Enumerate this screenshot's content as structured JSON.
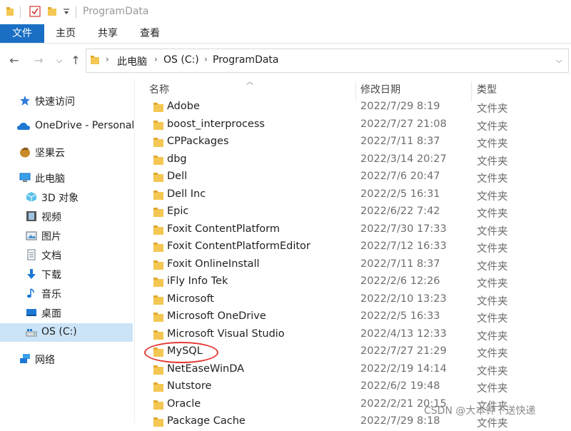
{
  "window": {
    "title": "ProgramData"
  },
  "ribbon": {
    "tabs": [
      "文件",
      "主页",
      "共享",
      "查看"
    ]
  },
  "address": {
    "path": [
      "此电脑",
      "OS (C:)",
      "ProgramData"
    ]
  },
  "sidebar": {
    "items": [
      {
        "label": "快速访问",
        "icon": "star-icon"
      },
      {
        "label": "OneDrive - Personal",
        "icon": "cloud-icon"
      },
      {
        "label": "坚果云",
        "icon": "nut-icon"
      },
      {
        "label": "此电脑",
        "icon": "computer-icon"
      },
      {
        "label": "3D 对象",
        "icon": "cube-icon"
      },
      {
        "label": "视频",
        "icon": "video-icon"
      },
      {
        "label": "图片",
        "icon": "picture-icon"
      },
      {
        "label": "文档",
        "icon": "document-icon"
      },
      {
        "label": "下载",
        "icon": "download-icon"
      },
      {
        "label": "音乐",
        "icon": "music-icon"
      },
      {
        "label": "桌面",
        "icon": "desktop-icon"
      },
      {
        "label": "OS (C:)",
        "icon": "drive-icon",
        "selected": true
      },
      {
        "label": "网络",
        "icon": "network-icon"
      }
    ]
  },
  "columns": {
    "name": "名称",
    "date": "修改日期",
    "type": "类型"
  },
  "files": [
    {
      "name": "Adobe",
      "date": "2022/7/29 8:19",
      "type": "文件夹"
    },
    {
      "name": "boost_interprocess",
      "date": "2022/7/27 21:08",
      "type": "文件夹"
    },
    {
      "name": "CPPackages",
      "date": "2022/7/11 8:37",
      "type": "文件夹"
    },
    {
      "name": "dbg",
      "date": "2022/3/14 20:27",
      "type": "文件夹"
    },
    {
      "name": "Dell",
      "date": "2022/7/6 20:47",
      "type": "文件夹"
    },
    {
      "name": "Dell Inc",
      "date": "2022/2/5 16:31",
      "type": "文件夹"
    },
    {
      "name": "Epic",
      "date": "2022/6/22 7:42",
      "type": "文件夹"
    },
    {
      "name": "Foxit ContentPlatform",
      "date": "2022/7/30 17:33",
      "type": "文件夹"
    },
    {
      "name": "Foxit ContentPlatformEditor",
      "date": "2022/7/12 16:33",
      "type": "文件夹"
    },
    {
      "name": "Foxit OnlineInstall",
      "date": "2022/7/11 8:37",
      "type": "文件夹"
    },
    {
      "name": "iFly Info Tek",
      "date": "2022/2/6 12:26",
      "type": "文件夹"
    },
    {
      "name": "Microsoft",
      "date": "2022/2/10 13:23",
      "type": "文件夹"
    },
    {
      "name": "Microsoft OneDrive",
      "date": "2022/2/5 16:33",
      "type": "文件夹"
    },
    {
      "name": "Microsoft Visual Studio",
      "date": "2022/4/13 12:33",
      "type": "文件夹"
    },
    {
      "name": "MySQL",
      "date": "2022/7/27 21:29",
      "type": "文件夹"
    },
    {
      "name": "NetEaseWinDA",
      "date": "2022/2/19 14:14",
      "type": "文件夹"
    },
    {
      "name": "Nutstore",
      "date": "2022/6/2 19:48",
      "type": "文件夹"
    },
    {
      "name": "Oracle",
      "date": "2022/2/21 20:15",
      "type": "文件夹"
    },
    {
      "name": "Package Cache",
      "date": "2022/7/29 8:18",
      "type": "文件夹"
    }
  ],
  "watermark": "CSDN @大本钟下送快递",
  "colors": {
    "accent": "#1a6fc4",
    "folder": "#f4c752",
    "selected": "#cce4f7",
    "annotation": "#e53935"
  }
}
